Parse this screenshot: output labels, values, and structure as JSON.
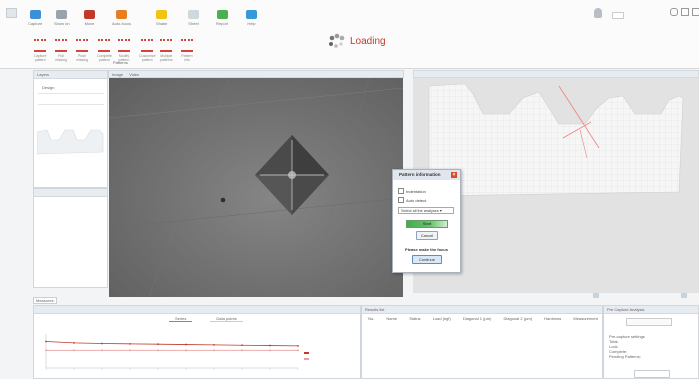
{
  "loading": {
    "label": "Loading"
  },
  "ribbon": {
    "top_buttons": [
      {
        "label": "Capture",
        "color": "#3d8fd9"
      },
      {
        "label": "Show on",
        "color": "#9aa3ad"
      },
      {
        "label": "Move",
        "color": "#c0392b"
      },
      {
        "label": "Auto-focus",
        "color": "#e67e22"
      },
      {
        "label": "Shake",
        "color": "#f1c40f"
      },
      {
        "label": "Sheet",
        "color": "#cfd8dc"
      },
      {
        "label": "Report",
        "color": "#4caf50"
      },
      {
        "label": "Help",
        "color": "#3498db"
      }
    ],
    "pattern_buttons": [
      {
        "label": "Capture\npattern",
        "icon": "dots-icon"
      },
      {
        "label": "Pull\nmissing",
        "icon": "arrow-left-icon"
      },
      {
        "label": "Push\nmissing",
        "icon": "arrow-up-icon"
      },
      {
        "label": "Complete\npattern",
        "icon": "play-icon"
      },
      {
        "label": "Modify\npattern",
        "icon": "swap-icon"
      },
      {
        "label": "Customize\npattern",
        "icon": "target-icon"
      },
      {
        "label": "Multiple\npatterns",
        "icon": "dots-icon"
      },
      {
        "label": "Pattern\ninfo",
        "icon": "grid-icon"
      }
    ],
    "group_label": "Patterns"
  },
  "left_panel": {
    "title": "Layers",
    "label": "Design"
  },
  "camera_tabs": [
    "Image",
    "Video"
  ],
  "right_panel": {
    "title": "Model view"
  },
  "dialog": {
    "title": "Pattern information",
    "indentation_label": "Indentation",
    "auto_detect_label": "Auto detect",
    "select_value": "Select all the analyses ▾",
    "start_button": "Start",
    "cancel_button": "Cancel",
    "prompt": "Please make the focus",
    "continue_button": "Continue"
  },
  "bottom": {
    "left_tab": "Measures",
    "chart_tabs": [
      "Series",
      "Data points"
    ],
    "results_title": "Results list",
    "table_headers": [
      "No.",
      "Name",
      "Status",
      "Load (kgf)",
      "Diagonal 1 (µm)",
      "Diagonal 2 (µm)",
      "Hardness",
      "Measurement"
    ],
    "side_title": "Pre Capture Analysis",
    "side_lines": [
      "Pre-capture settings",
      "Total:",
      "Lock:",
      "Complete:",
      "Pending Patterns:"
    ]
  },
  "chart_data": {
    "type": "line",
    "series": [
      {
        "name": "",
        "color": "#c0392b",
        "values": [
          0.78,
          0.74,
          0.72,
          0.71,
          0.7,
          0.69,
          0.68,
          0.67,
          0.66,
          0.65
        ]
      },
      {
        "name": "",
        "color": "#e8a0a0",
        "values": [
          0.52,
          0.52,
          0.52,
          0.52,
          0.52,
          0.52,
          0.52,
          0.52,
          0.52,
          0.52
        ]
      }
    ],
    "x": [
      1,
      2,
      3,
      4,
      5,
      6,
      7,
      8,
      9,
      10
    ]
  }
}
